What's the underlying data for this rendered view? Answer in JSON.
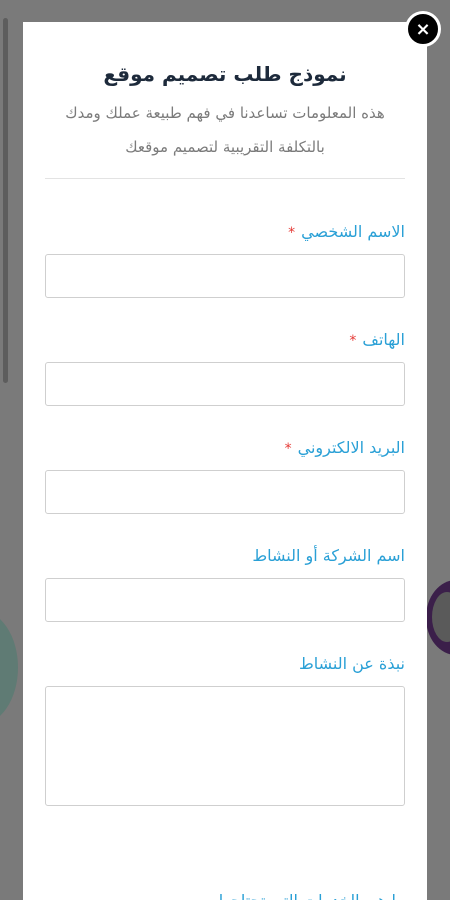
{
  "modal": {
    "close_label": "×",
    "title": "نموذج طلب تصميم موقع",
    "subtitle": "هذه المعلومات تساعدنا في فهم طبيعة عملك ومدك بالتكلفة التقريبية لتصميم موقعك"
  },
  "form": {
    "required_mark": "*",
    "fields": [
      {
        "label": "الاسم الشخصي",
        "required": true,
        "value": "",
        "placeholder": ""
      },
      {
        "label": "الهاتف",
        "required": true,
        "value": "",
        "placeholder": ""
      },
      {
        "label": "البريد الالكتروني",
        "required": true,
        "value": "",
        "placeholder": ""
      },
      {
        "label": "اسم الشركة أو النشاط",
        "required": false,
        "value": "",
        "placeholder": ""
      },
      {
        "label": "نبذة عن النشاط",
        "required": false,
        "value": "",
        "placeholder": ""
      }
    ],
    "next_label_partial": "ما هي الخدمات التي تحتاجها"
  }
}
